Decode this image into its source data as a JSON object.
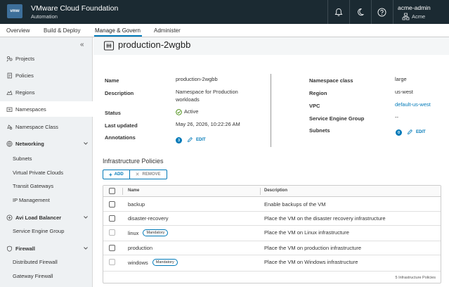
{
  "header": {
    "logo_text": "vmw",
    "title": "VMware Cloud Foundation",
    "subtitle": "Automation",
    "user_name": "acme-admin",
    "user_org": "Acme"
  },
  "tabs": [
    {
      "label": "Overview"
    },
    {
      "label": "Build & Deploy"
    },
    {
      "label": "Manage & Govern"
    },
    {
      "label": "Administer"
    }
  ],
  "sidebar": {
    "collapse_glyph": "«",
    "items": [
      {
        "label": "Projects"
      },
      {
        "label": "Policies"
      },
      {
        "label": "Regions"
      },
      {
        "label": "Namespaces"
      },
      {
        "label": "Namespace Class"
      }
    ],
    "groups": [
      {
        "label": "Networking",
        "children": [
          "Subnets",
          "Virtual Private Clouds",
          "Transit Gateways",
          "IP Management"
        ]
      },
      {
        "label": "Avi Load Balancer",
        "children": [
          "Service Engine Group"
        ]
      },
      {
        "label": "Firewall",
        "children": [
          "Distributed Firewall",
          "Gateway Firewall"
        ]
      }
    ]
  },
  "page": {
    "title": "production-2wgbb"
  },
  "details_left": {
    "name_label": "Name",
    "name_value": "production-2wgbb",
    "description_label": "Description",
    "description_value_1": "Namespace for Production",
    "description_value_2": "workloads",
    "status_label": "Status",
    "status_value": "Active",
    "updated_label": "Last updated",
    "updated_value": "May 26, 2026, 10:22:26 AM",
    "annotations_label": "Annotations",
    "annotations_count": "3",
    "annotations_edit": "EDIT"
  },
  "details_right": {
    "class_label": "Namespace class",
    "class_value": "large",
    "region_label": "Region",
    "region_value": "us-west",
    "vpc_label": "VPC",
    "vpc_value": "default-us-west",
    "seg_label": "Service Engine Group",
    "seg_value": "--",
    "subnets_label": "Subnets",
    "subnets_count": "0",
    "subnets_edit": "EDIT"
  },
  "infra": {
    "section_title": "Infrastructure Policies",
    "add_label": "ADD",
    "remove_label": "REMOVE",
    "col_name": "Name",
    "col_description": "Description",
    "rows": [
      {
        "name": "backup",
        "tag": "",
        "description": "Enable backups of the VM"
      },
      {
        "name": "disaster-recovery",
        "tag": "",
        "description": "Place the VM on the disaster recovery infrastructure"
      },
      {
        "name": "linux",
        "tag": "Mandatory",
        "description": "Place the VM on Linux infrastructure"
      },
      {
        "name": "production",
        "tag": "",
        "description": "Place the VM on production infrastructure"
      },
      {
        "name": "windows",
        "tag": "Mandatory",
        "description": "Place the VM on Windows infrastructure"
      }
    ],
    "footer": "5 Infrastructure Policies"
  },
  "colors": {
    "header_bg": "#1b2a32",
    "accent": "#0079b8",
    "status_green": "#3c8500"
  }
}
